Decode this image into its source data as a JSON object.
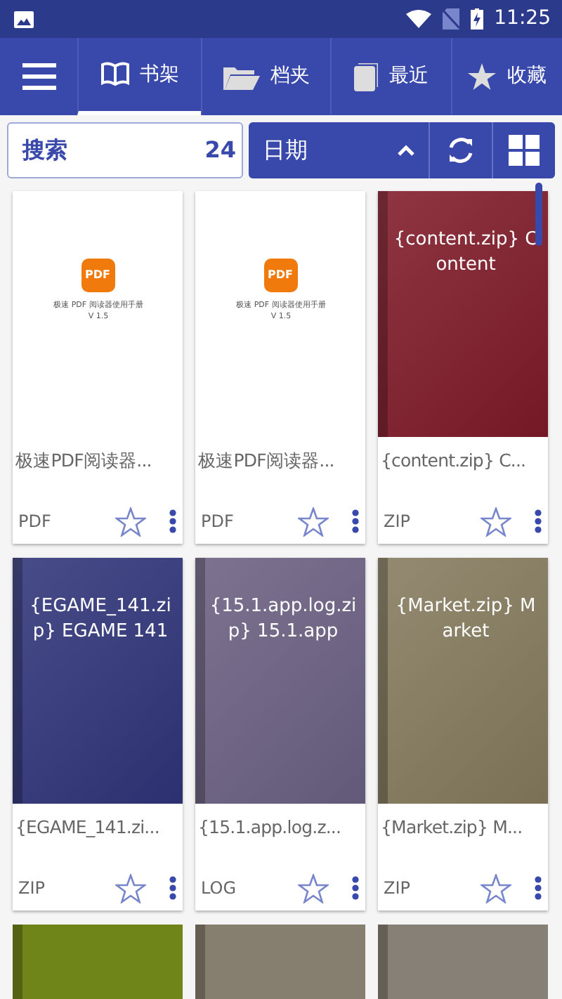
{
  "status_bar": {
    "time": "11:25"
  },
  "tabs": [
    {
      "label": "书架",
      "selected": true
    },
    {
      "label": "档夹",
      "selected": false
    },
    {
      "label": "最近",
      "selected": false
    },
    {
      "label": "收藏",
      "selected": false
    }
  ],
  "search": {
    "placeholder": "搜索",
    "count": "24"
  },
  "sort": {
    "label": "日期"
  },
  "books": [
    {
      "kind": "pdf",
      "cover_title": "极速 PDF 阅读器使用手册",
      "cover_version": "V 1.5",
      "logo": "PDF",
      "title": "极速PDF阅读器...",
      "type": "PDF",
      "favorite": false
    },
    {
      "kind": "pdf",
      "cover_title": "极速 PDF 阅读器使用手册",
      "cover_version": "V 1.5",
      "logo": "PDF",
      "title": "极速PDF阅读器...",
      "type": "PDF",
      "favorite": false
    },
    {
      "kind": "cover",
      "color": "#7f1a28",
      "cover_text": "{content.zip} Content",
      "title": "{content.zip} C...",
      "type": "ZIP",
      "favorite": false
    },
    {
      "kind": "cover",
      "color": "#2f3479",
      "cover_text": "{EGAME_141.zip} EGAME 141",
      "title": "{EGAME_141.zi...",
      "type": "ZIP",
      "favorite": false
    },
    {
      "kind": "cover",
      "color": "#6b6082",
      "cover_text": "{15.1.app.log.zip} 15.1.app",
      "title": "{15.1.app.log.z...",
      "type": "LOG",
      "favorite": false
    },
    {
      "kind": "cover",
      "color": "#847a5d",
      "cover_text": "{Market.zip} Market",
      "title": "{Market.zip} M...",
      "type": "ZIP",
      "favorite": false
    },
    {
      "kind": "partial",
      "color": "#6f8519"
    },
    {
      "kind": "partial",
      "color": "#867e6f"
    },
    {
      "kind": "partial",
      "color": "#868076"
    }
  ]
}
